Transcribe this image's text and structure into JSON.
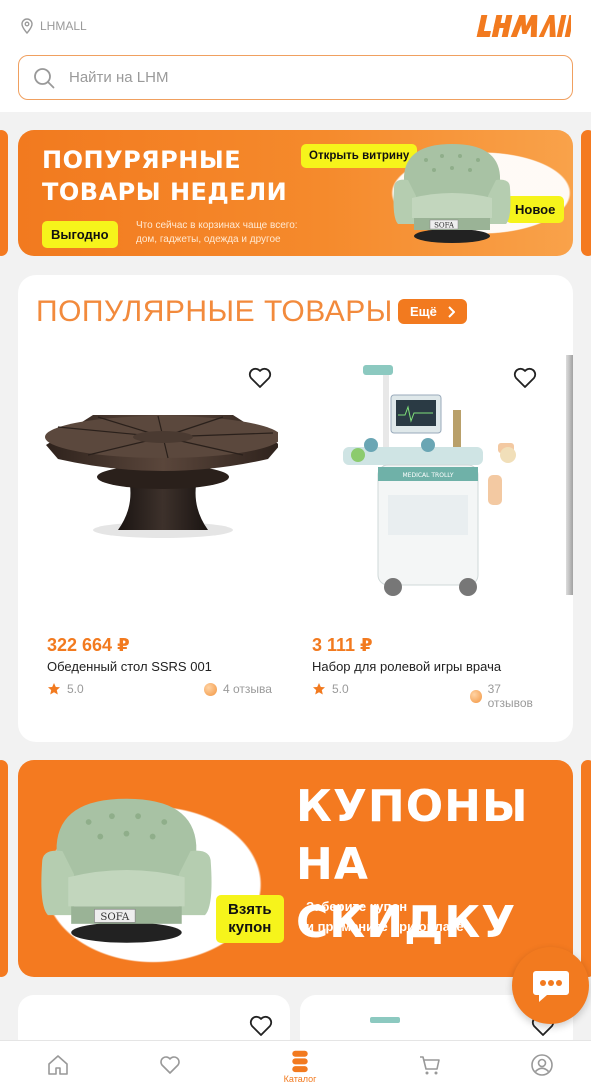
{
  "header": {
    "location_label": "LHMALL",
    "logo_text": "LHMALL",
    "search_placeholder": "Найти на LHM"
  },
  "banner_top": {
    "title_line1": "ПОПУРЯРНЫЕ",
    "title_line2": "ТОВАРЫ НЕДЕЛИ",
    "open_showcase": "Открыть витрину",
    "profitable": "Выгодно",
    "new": "Новое",
    "subtitle_line1": "Что сейчас в корзинах чаще всего:",
    "subtitle_line2": "дом, гаджеты, одежда и другое",
    "sofa_label": "SOFA"
  },
  "popular": {
    "title": "ПОПУЛЯРНЫЕ ТОВАРЫ",
    "more_label": "Ещё",
    "products": [
      {
        "price": "322 664 ₽",
        "name": "Обеденный стол SSRS 001",
        "rating": "5.0",
        "reviews": "4 отзыва"
      },
      {
        "price": "3 111 ₽",
        "name": "Набор для ролевой игры врача",
        "rating": "5.0",
        "reviews": "37 отзывов"
      }
    ]
  },
  "banner_coupon": {
    "title_line1": "КУПОНЫ",
    "title_line2": "НА СКИДКУ",
    "take_line1": "Взять",
    "take_line2": "купон",
    "sub_line1": "Заберите купон",
    "sub_line2": "и примените при оплате",
    "sofa_label": "SOFA"
  },
  "bottom_nav": {
    "items": [
      {
        "icon": "home-icon"
      },
      {
        "icon": "heart-icon"
      },
      {
        "icon": "catalog-icon",
        "label": "Каталог",
        "active": true
      },
      {
        "icon": "cart-icon"
      },
      {
        "icon": "profile-icon"
      }
    ]
  },
  "colors": {
    "accent": "#f27a1f",
    "tag_yellow": "#f6f41b",
    "muted": "#9a9a9a"
  }
}
